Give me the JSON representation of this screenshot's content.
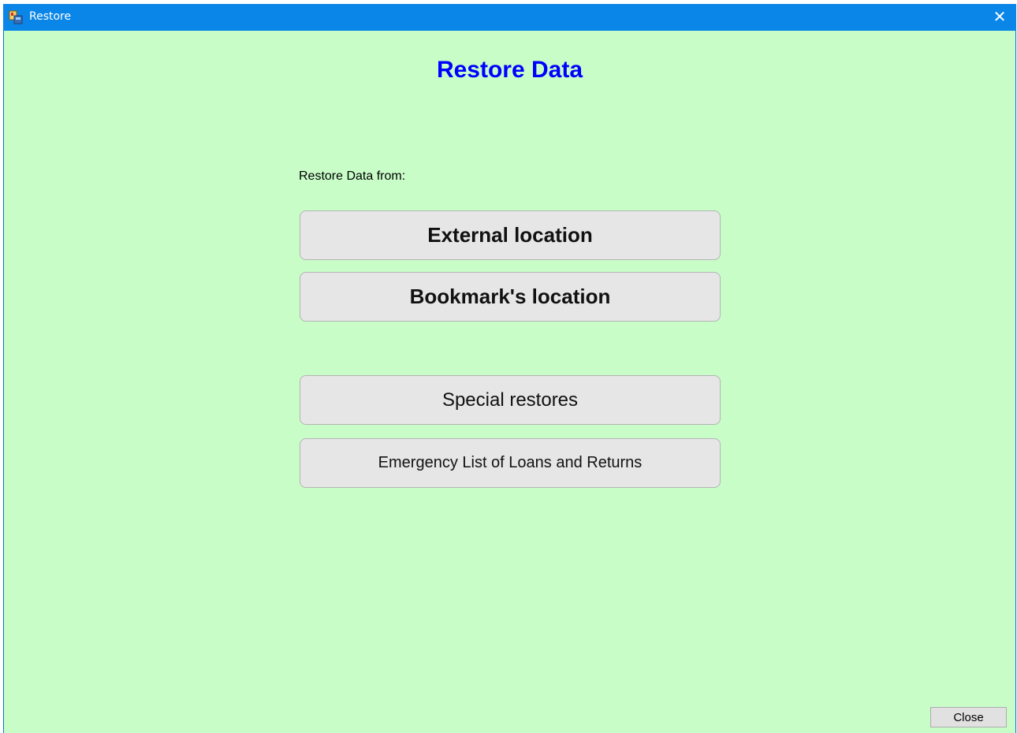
{
  "window": {
    "title": "Restore",
    "close_glyph": "✕"
  },
  "main": {
    "heading": "Restore Data",
    "from_label": "Restore Data from:",
    "buttons": {
      "external": "External location",
      "bookmark": "Bookmark's location",
      "special": "Special restores",
      "emergency": "Emergency List of Loans and Returns"
    }
  },
  "footer": {
    "close_label": "Close"
  },
  "colors": {
    "titlebar": "#0a86e8",
    "background": "#c8fdc8",
    "heading": "#0000ff",
    "button_face": "#e6e6e6"
  },
  "icons": {
    "app": "app-icon",
    "close": "close-icon"
  }
}
